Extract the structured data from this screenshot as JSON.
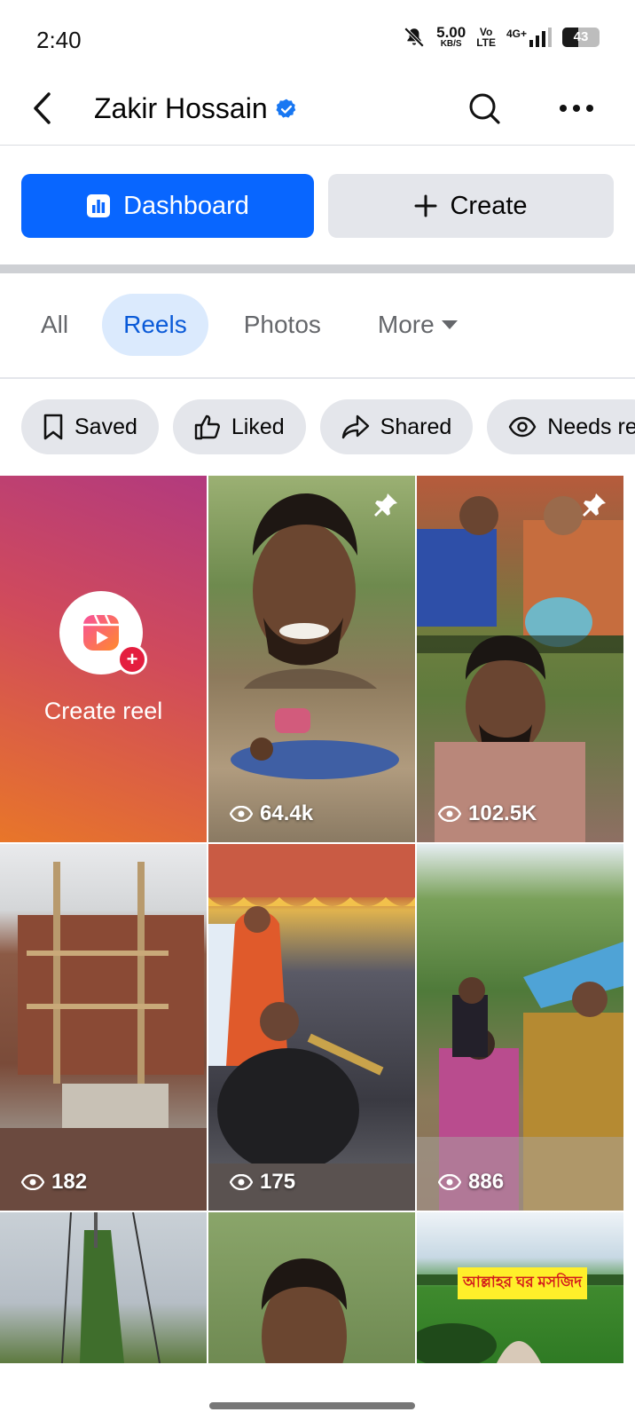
{
  "status_bar": {
    "time": "2:40",
    "speed_value": "5.00",
    "speed_unit": "KB/S",
    "volte_top": "Vo",
    "volte_bottom": "LTE",
    "network": "4G+",
    "battery": "43",
    "battery_level": 0.43
  },
  "header": {
    "title": "Zakir Hossain",
    "verified": true
  },
  "actions": {
    "dashboard_label": "Dashboard",
    "create_label": "Create"
  },
  "tabs": [
    {
      "label": "All",
      "active": false
    },
    {
      "label": "Reels",
      "active": true
    },
    {
      "label": "Photos",
      "active": false
    },
    {
      "label": "More",
      "active": false
    }
  ],
  "chips": [
    {
      "label": "Saved",
      "icon": "bookmark-icon"
    },
    {
      "label": "Liked",
      "icon": "thumbs-up-icon"
    },
    {
      "label": "Shared",
      "icon": "share-icon"
    },
    {
      "label": "Needs re",
      "icon": "eye-icon"
    }
  ],
  "create_reel": {
    "label": "Create reel"
  },
  "reels": [
    {
      "views": "64.4k",
      "pinned": true
    },
    {
      "views": "102.5K",
      "pinned": true
    },
    {
      "views": "182",
      "pinned": false
    },
    {
      "views": "175",
      "pinned": false
    },
    {
      "views": "886",
      "pinned": false
    }
  ],
  "row3": {
    "banner_text": "আল্লাহর ঘর মসজিদ"
  },
  "colors": {
    "accent": "#0866ff",
    "active_tab_bg": "#dbeafd",
    "active_tab_text": "#0a5ad8"
  }
}
